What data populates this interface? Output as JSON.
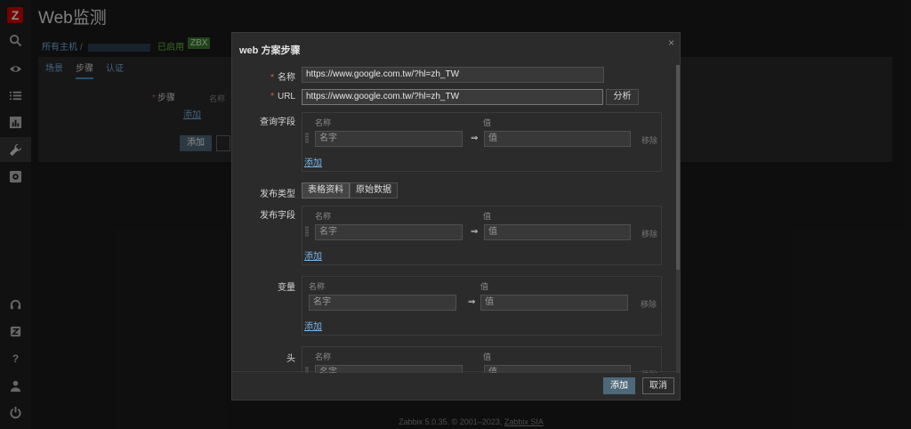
{
  "page": {
    "title": "Web监测",
    "breadcrumb_all_hosts": "所有主机",
    "breadcrumb_sep": "/",
    "enabled": "已启用",
    "zbx_badge": "ZBX",
    "tabs": [
      "场景",
      "步骤",
      "认证"
    ],
    "steps_label": "步骤",
    "steps_col_name": "名称",
    "add_link": "添加",
    "add_button": "添加",
    "footer_prefix": "Zabbix 5.0.35. © 2001–2023, ",
    "footer_link": "Zabbix SIA"
  },
  "modal": {
    "title": "web 方案步骤",
    "close": "×",
    "name_label": "名称",
    "name_value": "https://www.google.com.tw/?hl=zh_TW",
    "url_label": "URL",
    "url_value": "https://www.google.com.tw/?hl=zh_TW",
    "parse_button": "分析",
    "query_label": "查询字段",
    "post_type_label": "发布类型",
    "post_type_options": [
      "表格资料",
      "原始数据"
    ],
    "post_fields_label": "发布字段",
    "variables_label": "变量",
    "headers_label": "头",
    "col_name": "名称",
    "col_value": "值",
    "name_placeholder": "名字",
    "value_placeholder": "值",
    "arrow": "⇒",
    "remove": "移除",
    "add_link": "添加",
    "add_button": "添加",
    "cancel_button": "取消"
  }
}
